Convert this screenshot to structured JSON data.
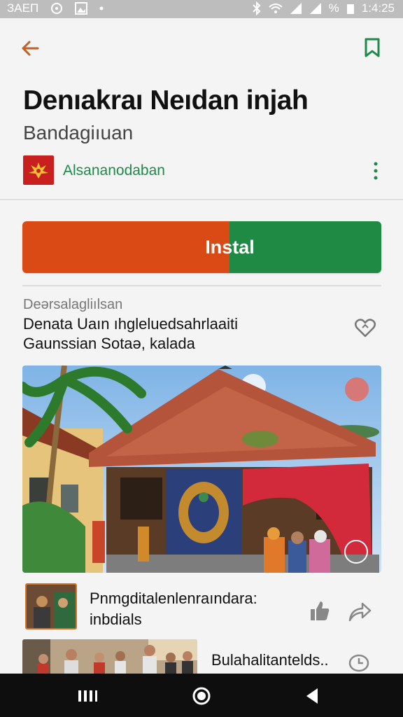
{
  "status_bar": {
    "left_icons": [
      "signal-icon",
      "sync-icon",
      "image-icon",
      "dot-icon"
    ],
    "left_text": "ЗАЕП",
    "battery": "%",
    "time": "1:4:25"
  },
  "header": {
    "title": "Denıakraı Neıdan injah",
    "subtitle": "Bandagiıuan",
    "developer": "Alsananodaban"
  },
  "install": {
    "label": "Instal",
    "color_left": "#d94a15",
    "color_right": "#1e8a44"
  },
  "description": {
    "section_label": "Deərsalagliılsan",
    "line1": "Denata Uaın ıhgleluedsahrlaaiti",
    "line2": "Gaunssian Sotaə, kalada"
  },
  "list": [
    {
      "title": "Pnmgditalenlenraındara:",
      "subtitle": "inbdials"
    },
    {
      "title": "Bulahalitantelds.."
    }
  ],
  "colors": {
    "accent_orange": "#d94a15",
    "accent_green": "#1e8a44",
    "back_arrow": "#c0612a",
    "bookmark": "#1e8a4a"
  }
}
